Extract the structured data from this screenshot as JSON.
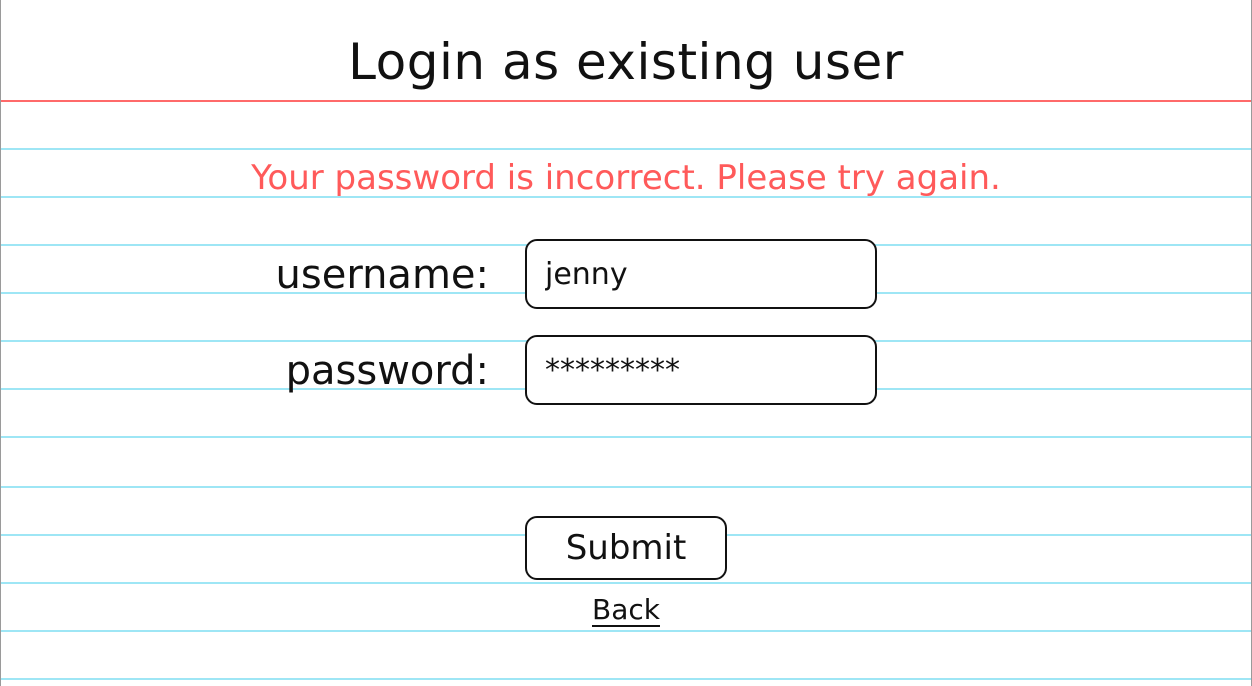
{
  "title": "Login as existing user",
  "error_message": "Your password is incorrect. Please try again.",
  "form": {
    "username_label": "username:",
    "username_value": "jenny",
    "password_label": "password:",
    "password_value": "*********",
    "submit_label": "Submit"
  },
  "back_link": "Back",
  "colors": {
    "margin_line": "#ff6a6a",
    "ruled_lines": "#9ee6f5",
    "error_text": "#ff5a5a",
    "ink": "#111111"
  }
}
